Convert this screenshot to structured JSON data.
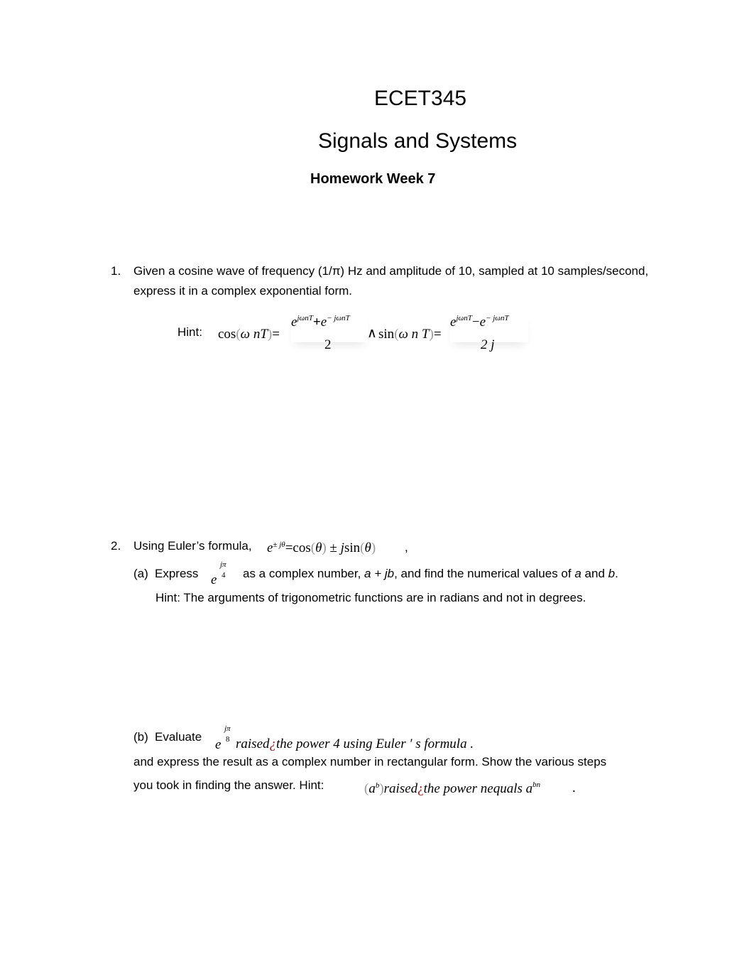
{
  "header": {
    "course": "ECET345",
    "subject": "Signals and Systems",
    "assignment": "Homework Week 7"
  },
  "q1": {
    "number": "1.",
    "line1": "Given a cosine wave of frequency (1/π) Hz and amplitude of 10, sampled at 10 samples/second,",
    "line2": "express it in a complex exponential form.",
    "hint_label": "Hint:",
    "cos_lhs": "cos",
    "arg1": "ω nT",
    "eq": "=",
    "num1_a": "e",
    "num1_a_exp": "jωnT",
    "num1_op": "+",
    "num1_b": "e",
    "num1_b_exp": "− jωnT",
    "den1": "2",
    "and": "∧",
    "sin_lhs": "sin",
    "arg2": "ω n T",
    "num2_a": "e",
    "num2_a_exp": "jωnT",
    "num2_op": "−",
    "num2_b": "e",
    "num2_b_exp": "− jωnT",
    "den2": "2 j"
  },
  "q2": {
    "number": "2.",
    "intro": "Using Euler’s formula,",
    "euler_e": "e",
    "euler_exp": "± jθ",
    "euler_rhs_eq": "=",
    "euler_cos": "cos",
    "theta": "θ",
    "pm": "±",
    "j": "j",
    "euler_sin": "sin",
    "comma": ",",
    "a": {
      "label": "(a)",
      "verb": "Express",
      "e": "e",
      "exp_num": "jπ",
      "exp_den": "4",
      "text_before": "as a complex number,",
      "form": "a + jb",
      "text_mid": ", and find the numerical values of",
      "var_a": "a",
      "and": "and",
      "var_b": "b",
      "period": ".",
      "hint": "Hint: The arguments of trigonometric functions are in radians and not in degrees."
    },
    "b": {
      "label": "(b)",
      "verb": "Evaluate",
      "e": "e",
      "exp_num": "jπ",
      "exp_den": "8",
      "raised": "raised",
      "glyph": "¿",
      "rest": "the power 4 using Euler ′ s formula .",
      "line2": "and express the result as a complex number in rectangular form. Show the various steps",
      "line3": "you took in finding the answer. Hint:",
      "hint_a": "a",
      "hint_b": "b",
      "hint_raised": "raised",
      "hint_rest": "the power nequals a",
      "hint_exp": "bn",
      "hint_end": "."
    }
  }
}
